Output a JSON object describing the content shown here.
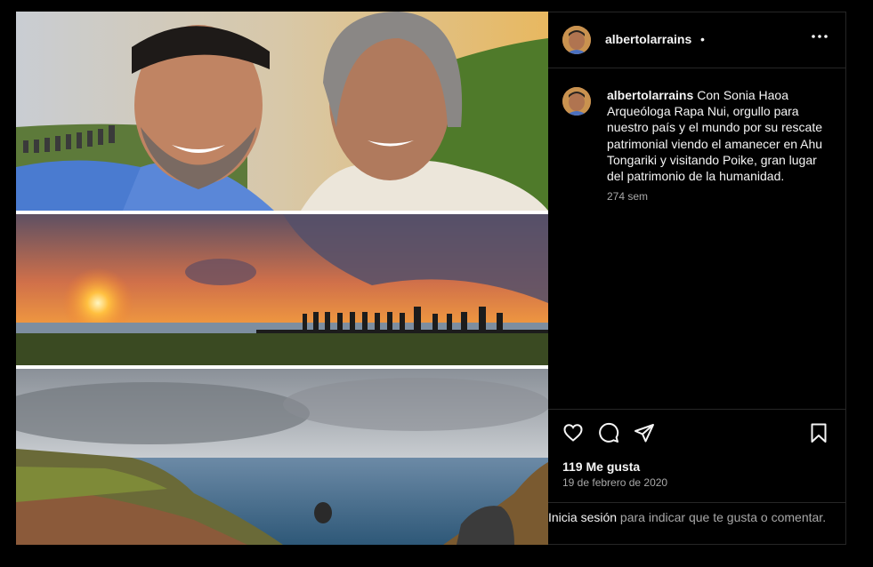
{
  "post": {
    "username": "albertolarrains",
    "separator": "•",
    "caption": "Con Sonia Haoa Arqueóloga Rapa Nui, orgullo para nuestro país y el mundo por su rescate patrimonial viendo el amanecer en Ahu Tongariki y visitando Poike, gran lugar del patrimonio de la humanidad.",
    "time_ago": "274 sem",
    "likes": "119 Me gusta",
    "date": "19 de febrero de 2020"
  },
  "login_prompt": {
    "link": "Inicia sesión",
    "text": " para indicar que te gusta o comentar."
  },
  "icons": [
    "more-options-icon",
    "heart-icon",
    "comment-icon",
    "share-icon",
    "bookmark-icon"
  ],
  "colors": {
    "background": "#000000",
    "text": "#f5f5f5",
    "secondary": "#a8a8a8",
    "border": "#262626"
  }
}
